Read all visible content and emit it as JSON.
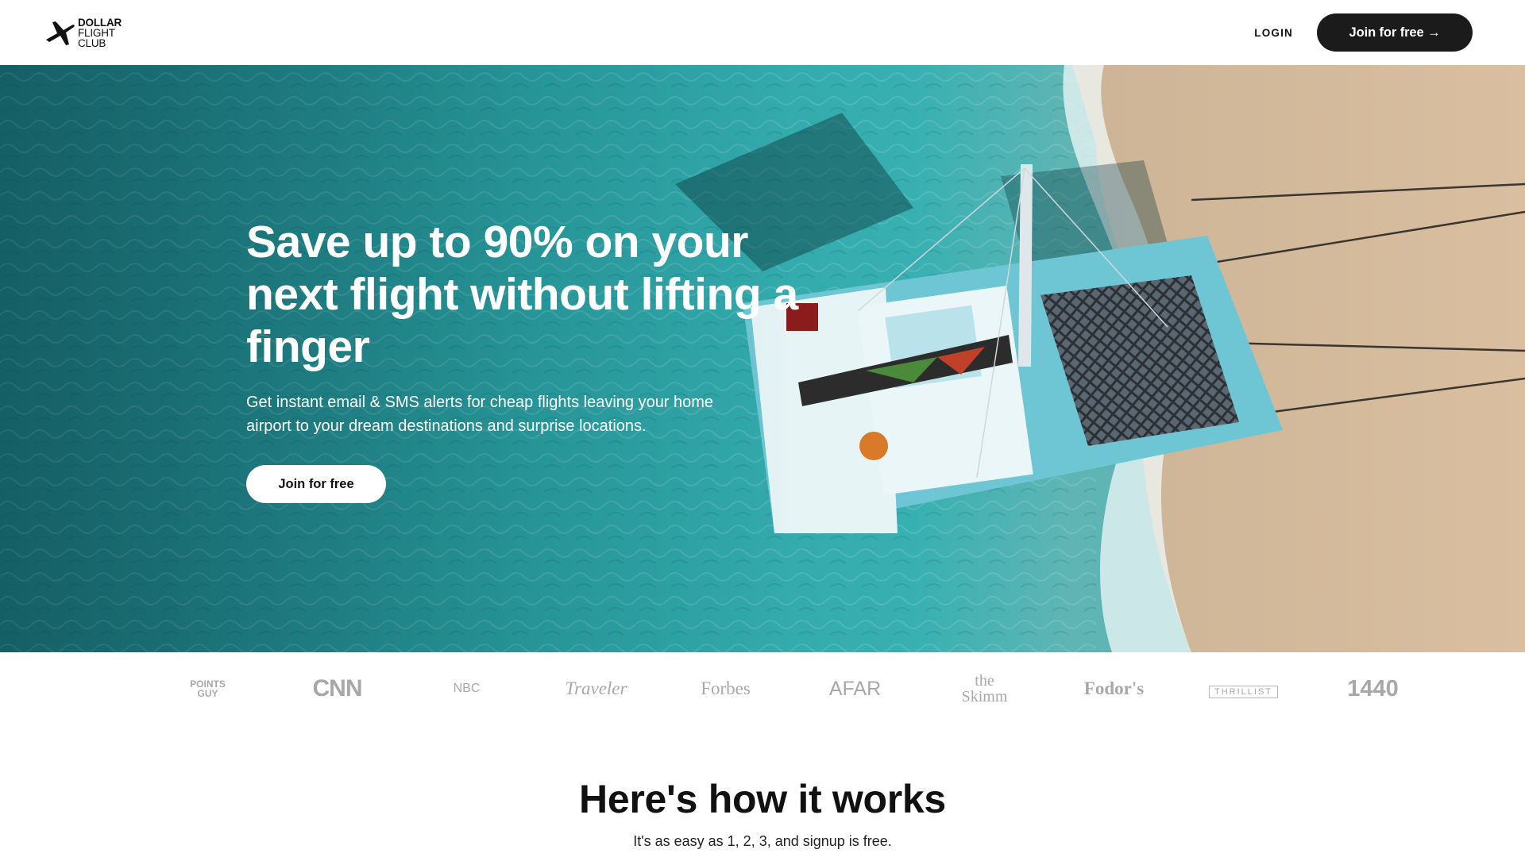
{
  "header": {
    "logo": {
      "line1": "DOLLAR",
      "line2": "FLIGHT",
      "line3": "CLUB",
      "icon": "airplane-icon"
    },
    "login_label": "LOGIN",
    "join_label": "Join for free →"
  },
  "hero": {
    "title": "Save up to 90% on your next flight without lifting a finger",
    "subtitle": "Get instant email & SMS alerts for cheap flights leaving your home airport to your dream destinations and surprise locations.",
    "cta_label": "Join for free",
    "image": "aerial view of a catamaran on turquoise water near a sandy beach"
  },
  "press": [
    {
      "name": "The Points Guy",
      "label": "POINTS\nGUY"
    },
    {
      "name": "CNN",
      "label": "CNN"
    },
    {
      "name": "NBC",
      "label": "NBC"
    },
    {
      "name": "Condé Nast Traveler",
      "label": "Traveler"
    },
    {
      "name": "Forbes",
      "label": "Forbes"
    },
    {
      "name": "AFAR",
      "label": "AFAR"
    },
    {
      "name": "theSkimm",
      "label": "the\nSkimm"
    },
    {
      "name": "Fodor's",
      "label": "Fodor's"
    },
    {
      "name": "Thrillist",
      "label": "THRILLIST"
    },
    {
      "name": "1440",
      "label": "1440"
    }
  ],
  "how": {
    "title": "Here's how it works",
    "subtitle": "It's as easy as 1, 2, 3, and signup is free."
  },
  "colors": {
    "dark_button": "#1b1b1b",
    "press_gray": "#a8a8a8",
    "water": "#2a9a9d",
    "sand": "#d6bb9a"
  }
}
